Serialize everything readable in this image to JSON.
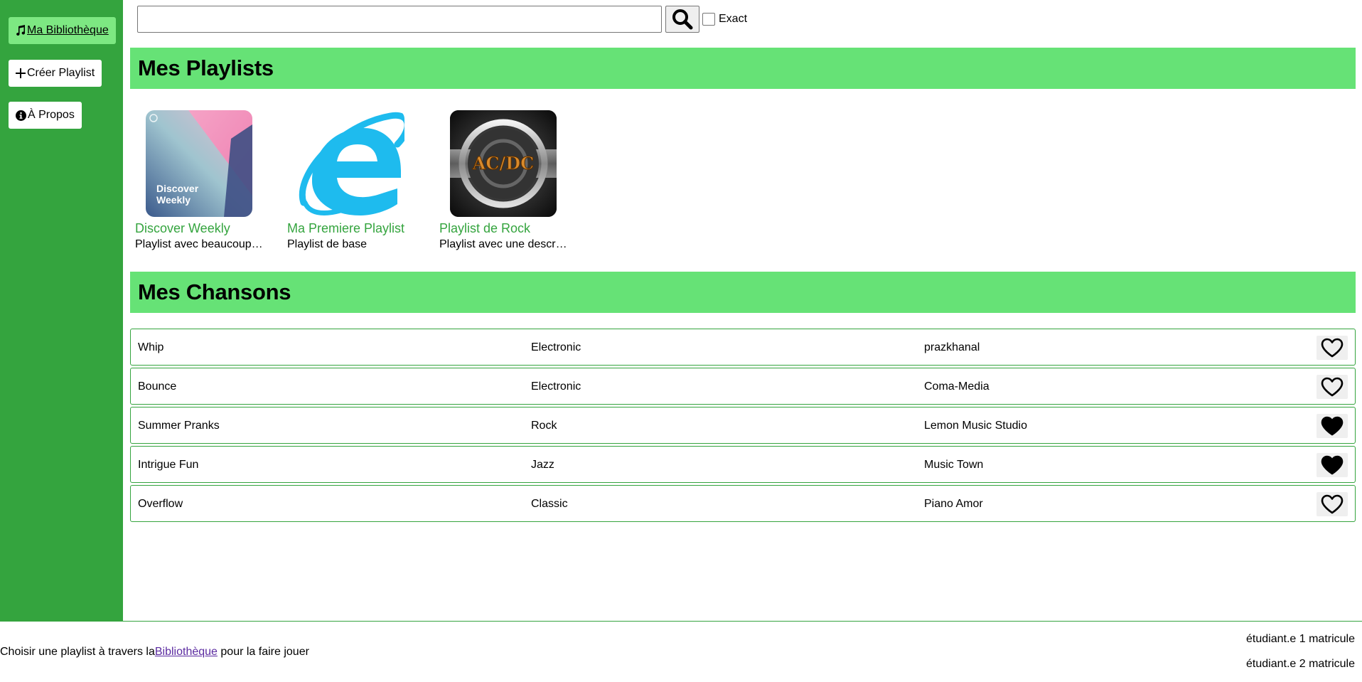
{
  "sidebar": {
    "items": [
      {
        "label": "Ma Bibliothèque",
        "icon": "music-note-icon",
        "active": true
      },
      {
        "label": "Créer Playlist",
        "icon": "plus-icon",
        "active": false
      },
      {
        "label": "À Propos",
        "icon": "info-icon",
        "active": false
      }
    ]
  },
  "search": {
    "value": "",
    "placeholder": "",
    "button_icon": "search-icon",
    "exact_label": "Exact",
    "exact_checked": false
  },
  "playlists_section": {
    "title": "Mes Playlists",
    "items": [
      {
        "name": "Discover Weekly",
        "description": "Playlist avec beaucoup de chansons",
        "cover_text": "Discover Weekly"
      },
      {
        "name": "Ma Premiere Playlist",
        "description": "Playlist de base",
        "cover_text": ""
      },
      {
        "name": "Playlist de Rock",
        "description": "Playlist avec une description",
        "cover_text": "AC/DC"
      }
    ]
  },
  "songs_section": {
    "title": "Mes Chansons",
    "rows": [
      {
        "title": "Whip",
        "genre": "Electronic",
        "artist": "prazkhanal",
        "liked": false
      },
      {
        "title": "Bounce",
        "genre": "Electronic",
        "artist": "Coma-Media",
        "liked": false
      },
      {
        "title": "Summer Pranks",
        "genre": "Rock",
        "artist": "Lemon Music Studio",
        "liked": true
      },
      {
        "title": "Intrigue Fun",
        "genre": "Jazz",
        "artist": "Music Town",
        "liked": true
      },
      {
        "title": "Overflow",
        "genre": "Classic",
        "artist": "Piano Amor",
        "liked": false
      }
    ]
  },
  "footer": {
    "text_before": "Choisir une playlist à travers la",
    "link_label": "Bibliothèque",
    "text_after": " pour la faire jouer",
    "students": [
      "étudiant.e 1 matricule",
      "étudiant.e 2 matricule"
    ]
  },
  "colors": {
    "sidebar": "#34a43e",
    "header": "#66e276",
    "active_nav": "#7de882",
    "playlist_name": "#34a43e"
  }
}
